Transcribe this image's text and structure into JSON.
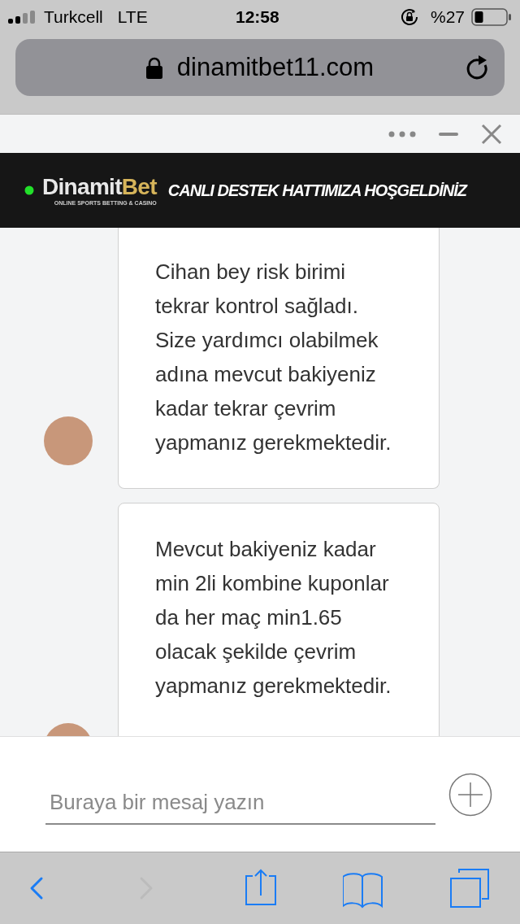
{
  "status_bar": {
    "carrier": "Turkcell",
    "network": "LTE",
    "time": "12:58",
    "battery": "%27"
  },
  "address_bar": {
    "url": "dinamitbet11.com"
  },
  "chat_header": {
    "banner": {
      "brand": [
        "Dinamit",
        "Bet"
      ],
      "tagline": "ONLINE SPORTS BETTING & CASINO",
      "headline": "CANLI DESTEK HATTIMIZA HOŞGELDİNİZ"
    }
  },
  "messages": [
    {
      "text": "Cihan bey risk birimi tekrar kontrol sağladı. Size yardımcı olabilmek adına mevcut bakiyeniz kadar tekrar çevrim yapmanız gerekmektedir."
    },
    {
      "text": "Mevcut bakiyeniz kadar min 2li kombine kuponlar da her maç min1.65 olacak şekilde çevrim yapmanız gerekmektedir."
    }
  ],
  "composer": {
    "placeholder": "Buraya bir mesaj yazın"
  },
  "toolbar": [
    {
      "kind": "back",
      "disabled": false
    },
    {
      "kind": "forward",
      "disabled": true
    },
    {
      "kind": "share",
      "disabled": false
    },
    {
      "kind": "bookmarks",
      "disabled": false
    },
    {
      "kind": "tabs",
      "disabled": false
    }
  ]
}
